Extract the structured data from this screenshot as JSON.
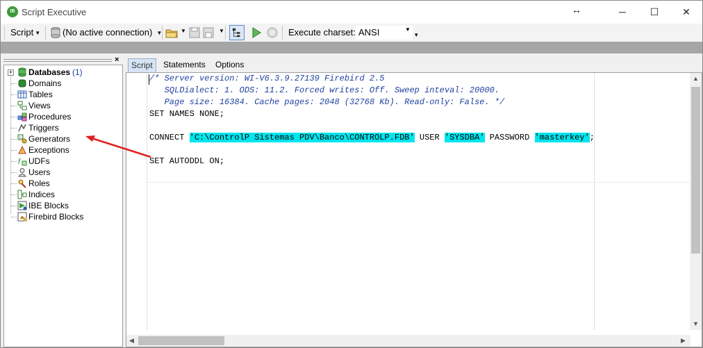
{
  "window": {
    "title": "Script Executive",
    "app_icon": "ibexpert-icon",
    "controls": {
      "minimize": "─",
      "maximize": "☐",
      "close": "✕"
    },
    "resize_icon": "↔"
  },
  "toolbar": {
    "script_menu": "Script",
    "connection": "(No active connection)",
    "charset_label": "Execute charset:",
    "charset_value": "ANSI"
  },
  "tree": {
    "root": {
      "label": "Databases",
      "count": "(1)",
      "icon": "database-icon"
    },
    "items": [
      {
        "label": "Domains",
        "icon": "domain-icon",
        "color": "#2e8b2e"
      },
      {
        "label": "Tables",
        "icon": "table-icon",
        "color": "#2a5db0"
      },
      {
        "label": "Views",
        "icon": "view-icon",
        "color": "#3a7a3a"
      },
      {
        "label": "Procedures",
        "icon": "procedure-icon",
        "color": "#2a5db0"
      },
      {
        "label": "Triggers",
        "icon": "trigger-icon",
        "color": "#555555"
      },
      {
        "label": "Generators",
        "icon": "generator-icon",
        "color": "#3a7a3a"
      },
      {
        "label": "Exceptions",
        "icon": "exception-icon",
        "color": "#b03030"
      },
      {
        "label": "UDFs",
        "icon": "udf-icon",
        "color": "#2e8b2e"
      },
      {
        "label": "Users",
        "icon": "user-icon",
        "color": "#555555"
      },
      {
        "label": "Roles",
        "icon": "role-icon",
        "color": "#b03030"
      },
      {
        "label": "Indices",
        "icon": "index-icon",
        "color": "#3a7a3a"
      },
      {
        "label": "IBE Blocks",
        "icon": "ibe-block-icon",
        "color": "#2a5db0"
      },
      {
        "label": "Firebird Blocks",
        "icon": "firebird-block-icon",
        "color": "#c08020"
      }
    ]
  },
  "tabs": [
    "Script",
    "Statements",
    "Options"
  ],
  "editor": {
    "comment": [
      "/* Server version: WI-V6.3.9.27139 Firebird 2.5",
      "   SQLDialect: 1. ODS: 11.2. Forced writes: Off. Sweep inteval: 20000.",
      "   Page size: 16384. Cache pages: 2048 (32768 Kb). Read-only: False. */"
    ],
    "line_set_names": "SET NAMES NONE;",
    "connect_kw": "CONNECT",
    "connect_path": "'C:\\ControlP Sistemas PDV\\Banco\\CONTROLP.FDB'",
    "user_kw": "USER",
    "user_val": "'SYSDBA'",
    "password_kw": "PASSWORD",
    "password_val": "'masterkey'",
    "terminator": ";",
    "line_autoddl": "SET AUTODDL ON;"
  },
  "colors": {
    "highlight": "#00e5ee",
    "comment": "#2040a0",
    "annotation_arrow": "#e02020"
  }
}
